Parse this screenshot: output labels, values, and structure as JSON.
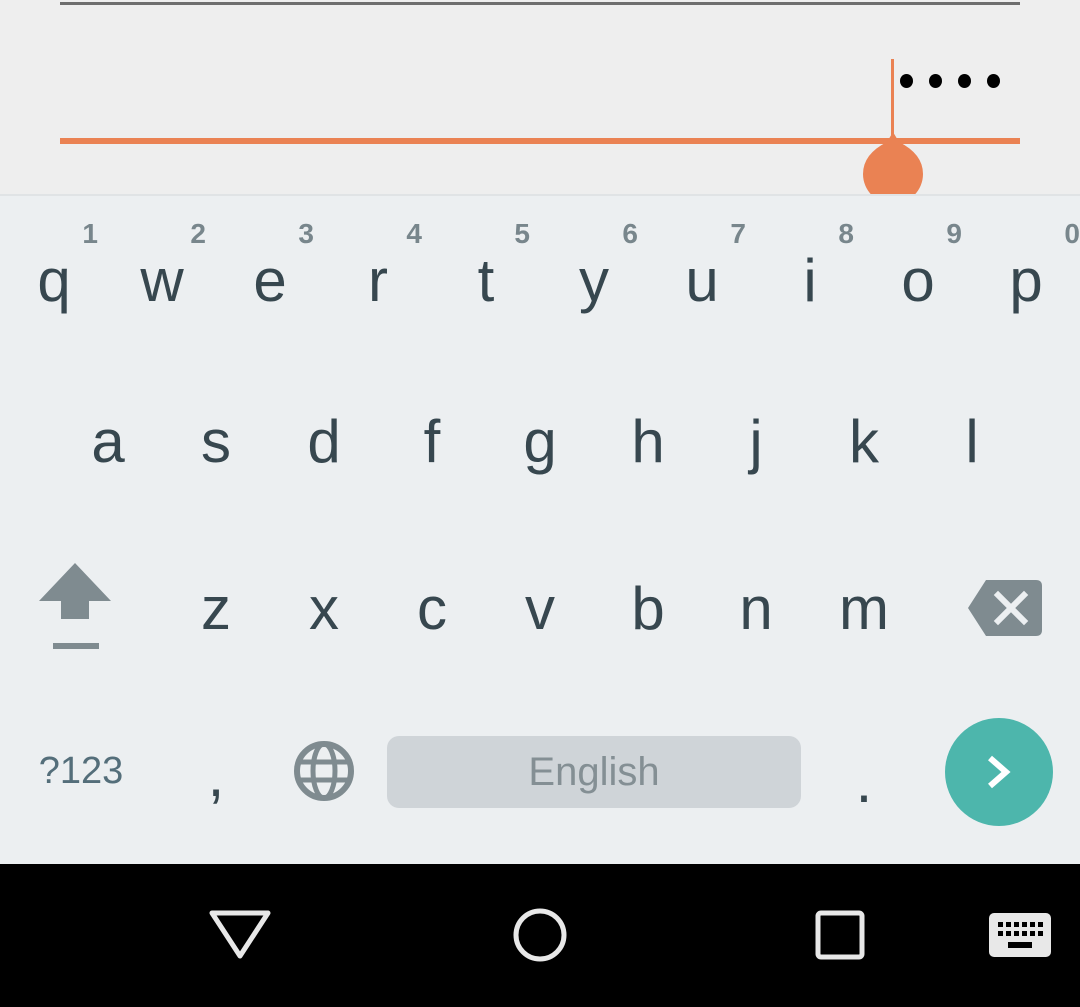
{
  "colors": {
    "accent": "#ea8253",
    "key_text": "#37474f",
    "hint_text": "#78868c",
    "keyboard_bg": "#eceff1",
    "enter_bg": "#4db6ac",
    "space_bg": "#cfd4d8"
  },
  "password_field": {
    "masked_value": "••••",
    "dot_count": 4,
    "focused": true
  },
  "keyboard": {
    "row1": [
      {
        "letter": "q",
        "hint": "1"
      },
      {
        "letter": "w",
        "hint": "2"
      },
      {
        "letter": "e",
        "hint": "3"
      },
      {
        "letter": "r",
        "hint": "4"
      },
      {
        "letter": "t",
        "hint": "5"
      },
      {
        "letter": "y",
        "hint": "6"
      },
      {
        "letter": "u",
        "hint": "7"
      },
      {
        "letter": "i",
        "hint": "8"
      },
      {
        "letter": "o",
        "hint": "9"
      },
      {
        "letter": "p",
        "hint": "0"
      }
    ],
    "row2": [
      "a",
      "s",
      "d",
      "f",
      "g",
      "h",
      "j",
      "k",
      "l"
    ],
    "row3": [
      "z",
      "x",
      "c",
      "v",
      "b",
      "n",
      "m"
    ],
    "shift_icon": "shift-arrow-icon",
    "delete_icon": "backspace-icon",
    "symbols_label": "?123",
    "comma_label": ",",
    "language_icon": "globe-icon",
    "space_label": "English",
    "period_label": ".",
    "enter_icon": "chevron-right-icon"
  },
  "navbar": {
    "back_icon": "back-triangle-icon",
    "home_icon": "home-circle-icon",
    "recents_icon": "recents-square-icon",
    "ime_switch_icon": "keyboard-icon"
  }
}
